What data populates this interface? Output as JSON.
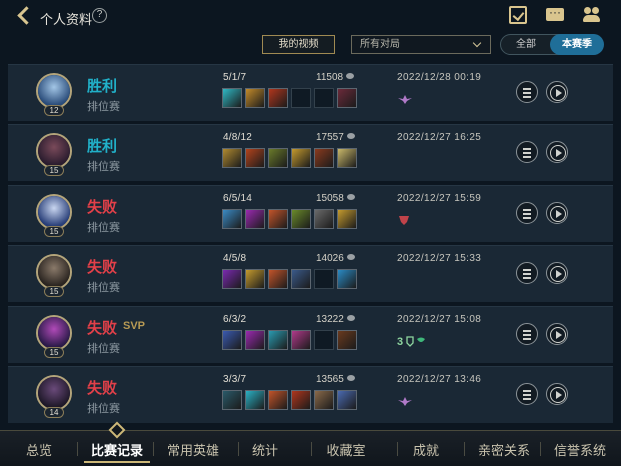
{
  "header": {
    "title": "个人资料",
    "help_icon": "?",
    "icons": [
      "back-arrow-icon",
      "help-icon",
      "task-icon",
      "chat-icon",
      "friends-icon"
    ]
  },
  "filters": {
    "my_videos": "我的视频",
    "mode_select": "所有对局",
    "segment_all": "全部",
    "segment_season": "本赛季",
    "segment_selected": "本赛季"
  },
  "matches": [
    {
      "result": "胜利",
      "outcome": "win",
      "mode": "排位赛",
      "level": "12",
      "kda": "5/1/7",
      "gold": "11508",
      "datetime": "2022/12/28 00:19",
      "svp": "",
      "badge_icon": "wing-badge-icon",
      "avatar_colors": [
        "#a3c6e6",
        "#2a4c7a"
      ],
      "items": [
        "#2fb8c4",
        "#c28a2a",
        "#b1361c",
        "",
        "",
        "#6b2a3a"
      ]
    },
    {
      "result": "胜利",
      "outcome": "win",
      "mode": "排位赛",
      "level": "15",
      "kda": "4/8/12",
      "gold": "17557",
      "datetime": "2022/12/27 16:25",
      "svp": "",
      "badge_icon": "",
      "avatar_colors": [
        "#7a4a5a",
        "#2a1c2e"
      ],
      "items": [
        "#b08a30",
        "#b2431d",
        "#6a7a2a",
        "#c49a2e",
        "#8a3a1e",
        "#c9b86a"
      ]
    },
    {
      "result": "失败",
      "outcome": "loss",
      "mode": "排位赛",
      "level": "15",
      "kda": "6/5/14",
      "gold": "15058",
      "datetime": "2022/12/27 15:59",
      "svp": "",
      "badge_icon": "flame-badge-icon",
      "avatar_colors": [
        "#c9d6f0",
        "#283e78"
      ],
      "items": [
        "#3a8ac4",
        "#9a2ab0",
        "#c2542a",
        "#6a8a2a",
        "#6a6a6a",
        "#c49a2e"
      ]
    },
    {
      "result": "失败",
      "outcome": "loss",
      "mode": "排位赛",
      "level": "15",
      "kda": "4/5/8",
      "gold": "14026",
      "datetime": "2022/12/27 15:33",
      "svp": "",
      "badge_icon": "",
      "avatar_colors": [
        "#8a7a6a",
        "#2a2420"
      ],
      "items": [
        "#7a2ab0",
        "#c49a2e",
        "#c2542a",
        "#3a5a8a",
        "",
        "#2a8ac4"
      ]
    },
    {
      "result": "失败",
      "outcome": "loss",
      "mode": "排位赛",
      "level": "15",
      "kda": "6/3/2",
      "gold": "13222",
      "datetime": "2022/12/27 15:08",
      "svp": "SVP",
      "badge_icon": "triple-kill-badge-icon",
      "avatar_colors": [
        "#b04ab8",
        "#2a1a48"
      ],
      "items": [
        "#3a5ab0",
        "#9a2ab0",
        "#2a9ab0",
        "#b03a8a",
        "",
        "#6a3a1e"
      ]
    },
    {
      "result": "失败",
      "outcome": "loss",
      "mode": "排位赛",
      "level": "14",
      "kda": "3/3/7",
      "gold": "13565",
      "datetime": "2022/12/27 13:46",
      "svp": "",
      "badge_icon": "wing-badge-icon",
      "avatar_colors": [
        "#6a4a7a",
        "#1e1828"
      ],
      "items": [
        "#2a5a6a",
        "#2ab0c4",
        "#c2542a",
        "#b1361c",
        "#8a6a4a",
        "#4a6ab0"
      ]
    }
  ],
  "bottom_tabs": [
    "总览",
    "比赛记录",
    "常用英雄",
    "统计",
    "收藏室",
    "成就",
    "亲密关系",
    "信誉系统"
  ],
  "active_tab": "比赛记录",
  "colors": {
    "win": "#21b1c9",
    "loss": "#e24049",
    "accent_gold": "#cdb878",
    "segment_active": "#1f6e98"
  }
}
